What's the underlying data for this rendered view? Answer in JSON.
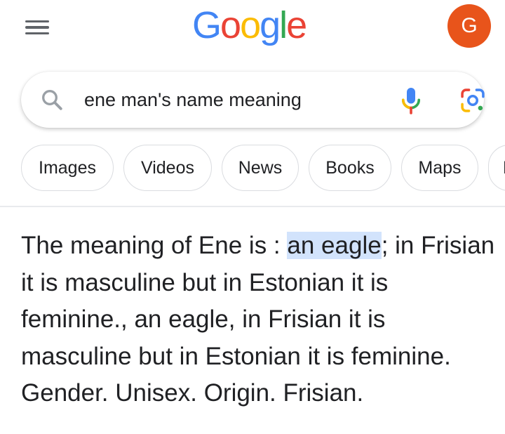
{
  "header": {
    "logo_letters": [
      "G",
      "o",
      "o",
      "g",
      "l",
      "e"
    ],
    "avatar_initial": "G",
    "avatar_color": "#e8541b"
  },
  "search": {
    "query": "ene man's name meaning"
  },
  "chips": [
    {
      "label": "Images"
    },
    {
      "label": "Videos"
    },
    {
      "label": "News"
    },
    {
      "label": "Books"
    },
    {
      "label": "Maps"
    },
    {
      "label": "F"
    }
  ],
  "answer": {
    "prefix": "The meaning of Ene is : ",
    "highlight": "an eagle",
    "rest": "; in Frisian it is masculine but in Estonian it is feminine., an eagle, in Frisian it is masculine but in Estonian it is feminine. Gender. Unisex. Origin. Frisian."
  },
  "colors": {
    "google_blue": "#4285F4",
    "google_red": "#EA4335",
    "google_yellow": "#FBBC05",
    "google_green": "#34A853",
    "highlight": "#d2e3fc"
  },
  "icons": {
    "menu": "hamburger-menu-icon",
    "search": "search-icon",
    "voice": "microphone-icon",
    "lens": "google-lens-icon"
  }
}
